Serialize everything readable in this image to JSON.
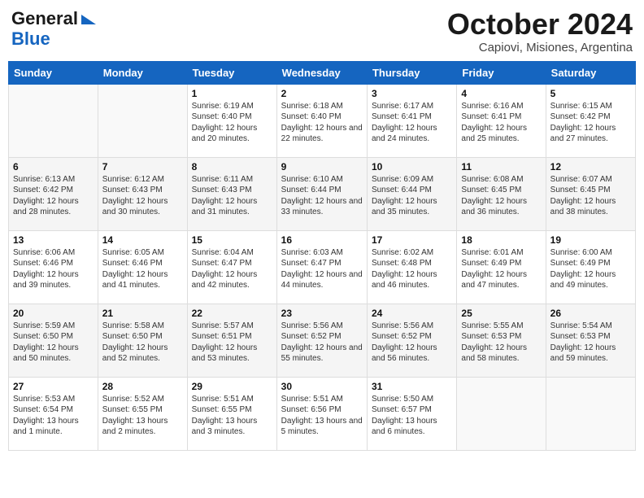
{
  "header": {
    "logo_line1": "General",
    "logo_line2": "Blue",
    "month": "October 2024",
    "location": "Capiovi, Misiones, Argentina"
  },
  "days_of_week": [
    "Sunday",
    "Monday",
    "Tuesday",
    "Wednesday",
    "Thursday",
    "Friday",
    "Saturday"
  ],
  "weeks": [
    [
      {
        "day": "",
        "info": ""
      },
      {
        "day": "",
        "info": ""
      },
      {
        "day": "1",
        "info": "Sunrise: 6:19 AM\nSunset: 6:40 PM\nDaylight: 12 hours and 20 minutes."
      },
      {
        "day": "2",
        "info": "Sunrise: 6:18 AM\nSunset: 6:40 PM\nDaylight: 12 hours and 22 minutes."
      },
      {
        "day": "3",
        "info": "Sunrise: 6:17 AM\nSunset: 6:41 PM\nDaylight: 12 hours and 24 minutes."
      },
      {
        "day": "4",
        "info": "Sunrise: 6:16 AM\nSunset: 6:41 PM\nDaylight: 12 hours and 25 minutes."
      },
      {
        "day": "5",
        "info": "Sunrise: 6:15 AM\nSunset: 6:42 PM\nDaylight: 12 hours and 27 minutes."
      }
    ],
    [
      {
        "day": "6",
        "info": "Sunrise: 6:13 AM\nSunset: 6:42 PM\nDaylight: 12 hours and 28 minutes."
      },
      {
        "day": "7",
        "info": "Sunrise: 6:12 AM\nSunset: 6:43 PM\nDaylight: 12 hours and 30 minutes."
      },
      {
        "day": "8",
        "info": "Sunrise: 6:11 AM\nSunset: 6:43 PM\nDaylight: 12 hours and 31 minutes."
      },
      {
        "day": "9",
        "info": "Sunrise: 6:10 AM\nSunset: 6:44 PM\nDaylight: 12 hours and 33 minutes."
      },
      {
        "day": "10",
        "info": "Sunrise: 6:09 AM\nSunset: 6:44 PM\nDaylight: 12 hours and 35 minutes."
      },
      {
        "day": "11",
        "info": "Sunrise: 6:08 AM\nSunset: 6:45 PM\nDaylight: 12 hours and 36 minutes."
      },
      {
        "day": "12",
        "info": "Sunrise: 6:07 AM\nSunset: 6:45 PM\nDaylight: 12 hours and 38 minutes."
      }
    ],
    [
      {
        "day": "13",
        "info": "Sunrise: 6:06 AM\nSunset: 6:46 PM\nDaylight: 12 hours and 39 minutes."
      },
      {
        "day": "14",
        "info": "Sunrise: 6:05 AM\nSunset: 6:46 PM\nDaylight: 12 hours and 41 minutes."
      },
      {
        "day": "15",
        "info": "Sunrise: 6:04 AM\nSunset: 6:47 PM\nDaylight: 12 hours and 42 minutes."
      },
      {
        "day": "16",
        "info": "Sunrise: 6:03 AM\nSunset: 6:47 PM\nDaylight: 12 hours and 44 minutes."
      },
      {
        "day": "17",
        "info": "Sunrise: 6:02 AM\nSunset: 6:48 PM\nDaylight: 12 hours and 46 minutes."
      },
      {
        "day": "18",
        "info": "Sunrise: 6:01 AM\nSunset: 6:49 PM\nDaylight: 12 hours and 47 minutes."
      },
      {
        "day": "19",
        "info": "Sunrise: 6:00 AM\nSunset: 6:49 PM\nDaylight: 12 hours and 49 minutes."
      }
    ],
    [
      {
        "day": "20",
        "info": "Sunrise: 5:59 AM\nSunset: 6:50 PM\nDaylight: 12 hours and 50 minutes."
      },
      {
        "day": "21",
        "info": "Sunrise: 5:58 AM\nSunset: 6:50 PM\nDaylight: 12 hours and 52 minutes."
      },
      {
        "day": "22",
        "info": "Sunrise: 5:57 AM\nSunset: 6:51 PM\nDaylight: 12 hours and 53 minutes."
      },
      {
        "day": "23",
        "info": "Sunrise: 5:56 AM\nSunset: 6:52 PM\nDaylight: 12 hours and 55 minutes."
      },
      {
        "day": "24",
        "info": "Sunrise: 5:56 AM\nSunset: 6:52 PM\nDaylight: 12 hours and 56 minutes."
      },
      {
        "day": "25",
        "info": "Sunrise: 5:55 AM\nSunset: 6:53 PM\nDaylight: 12 hours and 58 minutes."
      },
      {
        "day": "26",
        "info": "Sunrise: 5:54 AM\nSunset: 6:53 PM\nDaylight: 12 hours and 59 minutes."
      }
    ],
    [
      {
        "day": "27",
        "info": "Sunrise: 5:53 AM\nSunset: 6:54 PM\nDaylight: 13 hours and 1 minute."
      },
      {
        "day": "28",
        "info": "Sunrise: 5:52 AM\nSunset: 6:55 PM\nDaylight: 13 hours and 2 minutes."
      },
      {
        "day": "29",
        "info": "Sunrise: 5:51 AM\nSunset: 6:55 PM\nDaylight: 13 hours and 3 minutes."
      },
      {
        "day": "30",
        "info": "Sunrise: 5:51 AM\nSunset: 6:56 PM\nDaylight: 13 hours and 5 minutes."
      },
      {
        "day": "31",
        "info": "Sunrise: 5:50 AM\nSunset: 6:57 PM\nDaylight: 13 hours and 6 minutes."
      },
      {
        "day": "",
        "info": ""
      },
      {
        "day": "",
        "info": ""
      }
    ]
  ]
}
